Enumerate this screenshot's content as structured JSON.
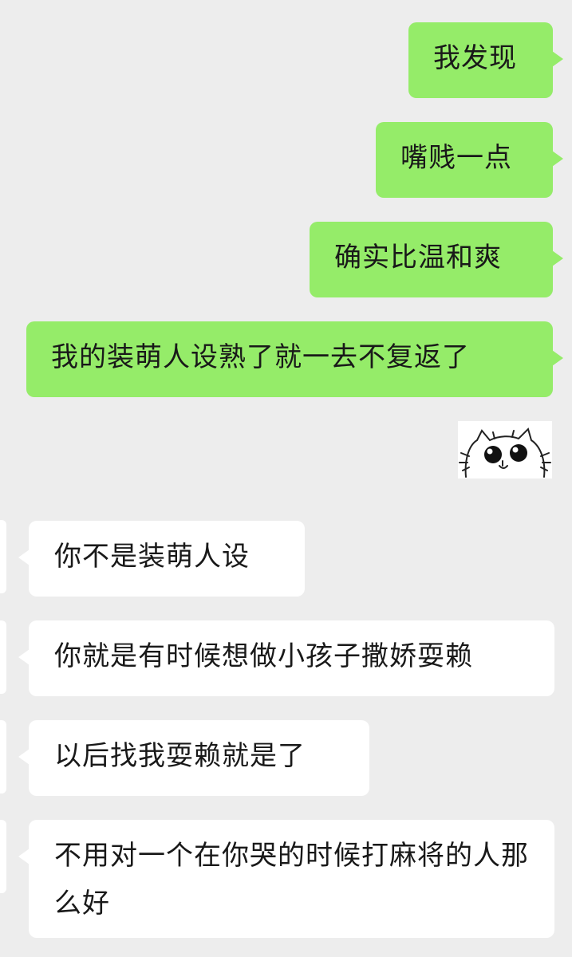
{
  "conversation": {
    "sent": [
      {
        "text": "我发现"
      },
      {
        "text": "嘴贱一点"
      },
      {
        "text": "确实比温和爽"
      },
      {
        "text": "我的装萌人设熟了就一去不复返了"
      }
    ],
    "sticker": {
      "icon": "cat-face-sticker-icon"
    },
    "received": [
      {
        "text": "你不是装萌人设"
      },
      {
        "text": "你就是有时候想做小孩子撒娇耍赖"
      },
      {
        "text": "以后找我耍赖就是了"
      },
      {
        "text": "不用对一个在你哭的时候打麻将的人那么好"
      }
    ]
  },
  "colors": {
    "background": "#ededed",
    "sent_bubble": "#95ec69",
    "received_bubble": "#ffffff",
    "text": "#191919"
  }
}
